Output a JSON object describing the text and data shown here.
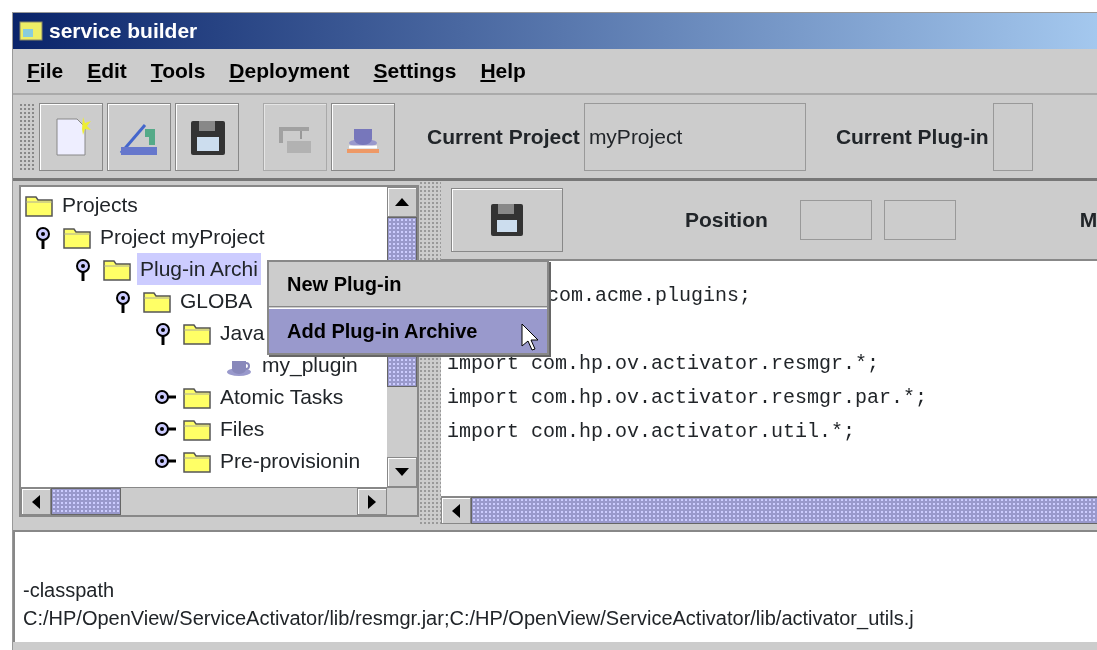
{
  "window": {
    "title": "service builder"
  },
  "menu": [
    {
      "label": "File"
    },
    {
      "label": "Edit"
    },
    {
      "label": "Tools"
    },
    {
      "label": "Deployment"
    },
    {
      "label": "Settings"
    },
    {
      "label": "Help"
    }
  ],
  "toolbar": {
    "buttons": [
      {
        "kind": "new",
        "disabled": false
      },
      {
        "kind": "import",
        "disabled": false
      },
      {
        "kind": "save",
        "disabled": false
      },
      {
        "kind": "deploy",
        "disabled": true
      },
      {
        "kind": "java",
        "disabled": false
      }
    ],
    "current_project": {
      "label": "Current Project",
      "value": "myProject"
    },
    "current_plugin": {
      "label": "Current Plug-in"
    }
  },
  "tree": [
    {
      "label": "Projects",
      "kind": "folder",
      "selected": false,
      "children": [
        {
          "label": "Project myProject",
          "kind": "folder",
          "expanded": true,
          "selected": false,
          "children": [
            {
              "label": "Plug-in Archi",
              "kind": "folder",
              "expanded": true,
              "selected": true,
              "children": [
                {
                  "label": "GLOBA",
                  "kind": "folder",
                  "expanded": true,
                  "selected": false,
                  "children": [
                    {
                      "label": "Java",
                      "kind": "folder",
                      "expanded": true,
                      "selected": false,
                      "children": [
                        {
                          "label": "my_plugin",
                          "kind": "java",
                          "selected": false
                        }
                      ]
                    },
                    {
                      "label": "Atomic Tasks",
                      "kind": "folder",
                      "expanded": false,
                      "selected": false
                    },
                    {
                      "label": "Files",
                      "kind": "folder",
                      "expanded": false,
                      "selected": false
                    },
                    {
                      "label": "Pre-provisionin",
                      "kind": "folder",
                      "expanded": false,
                      "selected": false
                    }
                  ]
                }
              ]
            }
          ]
        }
      ]
    }
  ],
  "popup_menu": [
    {
      "label": "New Plug-in",
      "selected": false
    },
    {
      "label": "Add Plug-in Archive",
      "selected": true
    }
  ],
  "editor": {
    "position_label": "Position",
    "cut_label": "M",
    "code_lines": [
      "com.acme.plugins;",
      "import com.hp.ov.activator.resmgr.*;",
      "import com.hp.ov.activator.resmgr.par.*;",
      "import com.hp.ov.activator.util.*;"
    ]
  },
  "log_lines": [
    "-classpath",
    "C:/HP/OpenView/ServiceActivator/lib/resmgr.jar;C:/HP/OpenView/ServiceActivator/lib/activator_utils.j"
  ]
}
